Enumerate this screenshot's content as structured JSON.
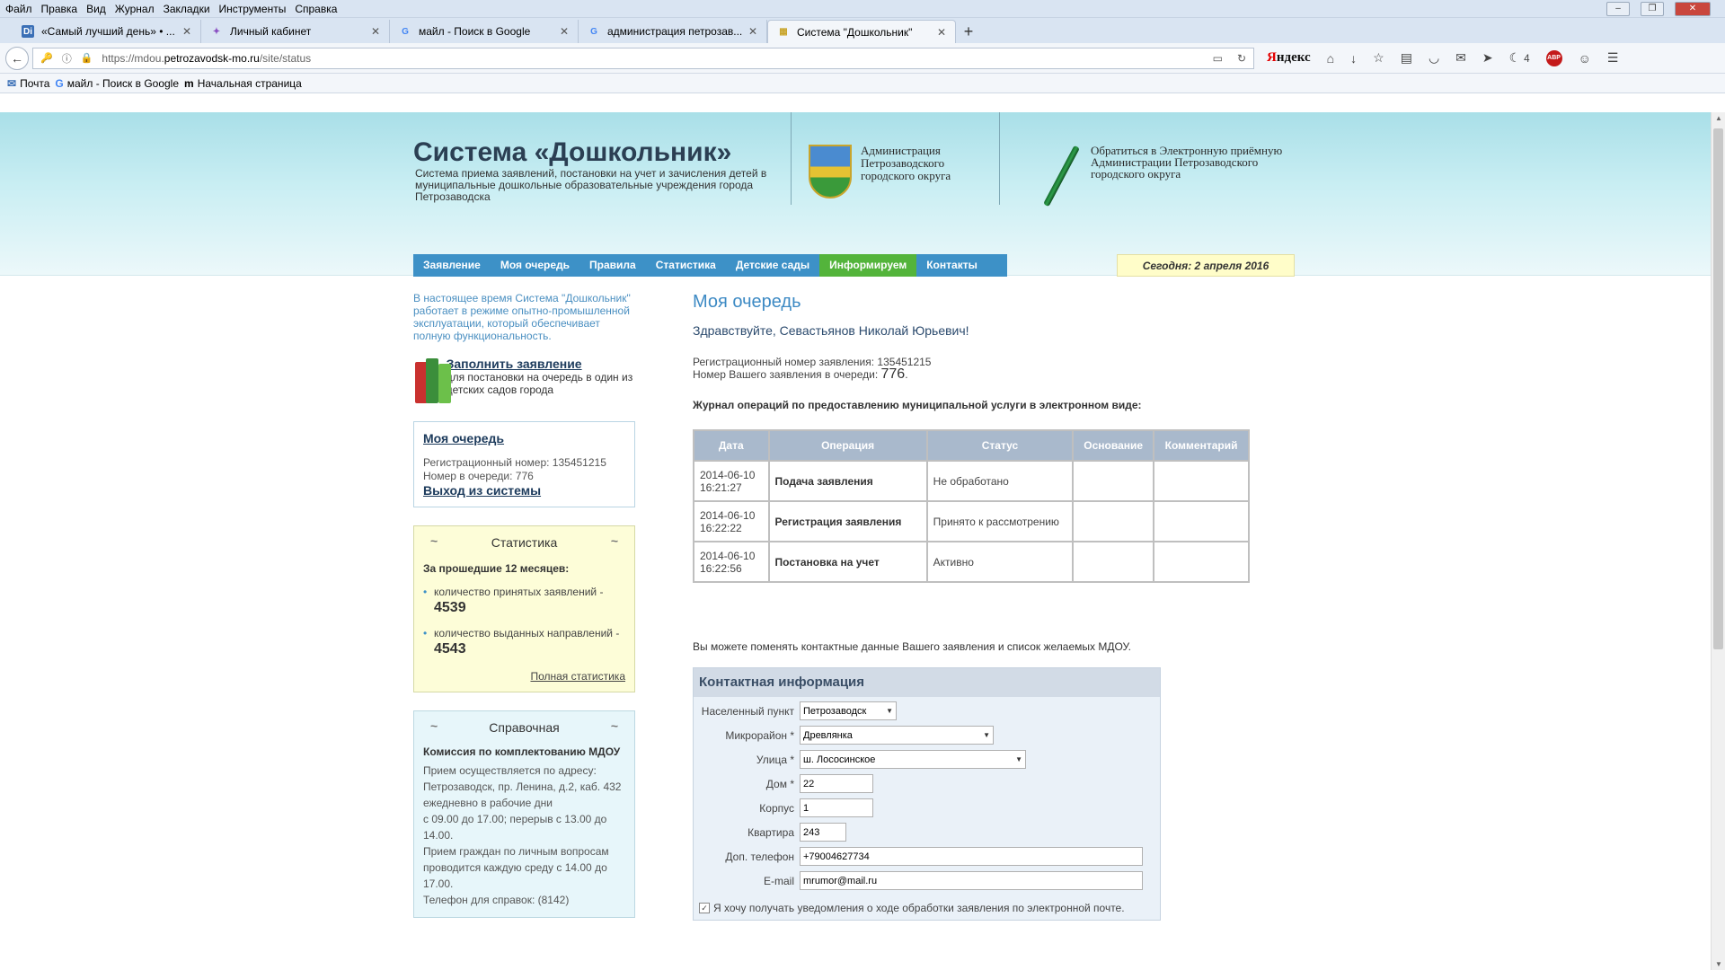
{
  "menubar": {
    "items": [
      "Файл",
      "Правка",
      "Вид",
      "Журнал",
      "Закладки",
      "Инструменты",
      "Справка"
    ]
  },
  "tabs": [
    {
      "label": "«Самый лучший день» • ...",
      "icon": "Di",
      "icon_color": "#3a6fb6"
    },
    {
      "label": "Личный кабинет",
      "icon": "✦",
      "icon_color": "#8a4fc2"
    },
    {
      "label": "майл - Поиск в Google",
      "icon": "G",
      "icon_color": "#4285f4"
    },
    {
      "label": "администрация петрозав...",
      "icon": "G",
      "icon_color": "#4285f4"
    },
    {
      "label": "Система \"Дошкольник\"",
      "icon": "▦",
      "icon_color": "#c9a52b"
    }
  ],
  "url": {
    "prefix": "https://mdou.",
    "domain": "petrozavodsk-mo.ru",
    "path": "/site/status"
  },
  "toolbar": {
    "yandex": "Яндекс",
    "badge": "4",
    "abp": "ABP"
  },
  "bookmarks": [
    {
      "icon": "✉",
      "label": "Почта"
    },
    {
      "icon": "G",
      "label": "майл - Поиск в Google"
    },
    {
      "icon": "m",
      "label": "Начальная страница"
    }
  ],
  "header": {
    "title": "Система «Дошкольник»",
    "subtitle": "Система  приема заявлений, постановки на учет и зачисления детей в муниципальные дошкольные образовательные учреждения города Петрозаводска",
    "admin": [
      "Администрация",
      "Петрозаводского",
      "городского округа"
    ],
    "reception": [
      "Обратиться в Электронную приёмную",
      "Администрации Петрозаводского",
      "городского округа"
    ]
  },
  "nav": [
    "Заявление",
    "Моя очередь",
    "Правила",
    "Статистика",
    "Детские сады",
    "Информируем",
    "Контакты"
  ],
  "today": "Сегодня: 2 апреля 2016",
  "left": {
    "notice": "В настоящее время Система \"Дошкольник\" работает в режиме опытно-промышленной эксплуатации, который обеспечивает полную функциональность.",
    "fill_link": "Заполнить заявление",
    "fill_desc": "для постановки на очередь в один из детских садов города",
    "queue_title": "Моя очередь",
    "reg_line": "Регистрационный номер: 135451215",
    "queue_line": "Номер в очереди: 776",
    "logout": "Выход из системы",
    "stats_title": "Статистика",
    "stats_sub": "За прошедшие 12 месяцев:",
    "stat1_text": "количество принятых заявлений -",
    "stat1_val": "4539",
    "stat2_text": "количество выданных направлений -",
    "stat2_val": "4543",
    "full_stats": "Полная статистика",
    "info_title_head": "Справочная",
    "info_title": "Комиссия по комплектованию МДОУ",
    "info_text1": "Прием осуществляется по адресу: Петрозаводск, пр. Ленина, д.2, каб. 432 ежедневно в рабочие дни",
    "info_text2": "с 09.00 до 17.00; перерыв с 13.00 до 14.00.",
    "info_text3": "Прием граждан по личным вопросам проводится каждую среду с 14.00 до 17.00.",
    "info_text4": "Телефон для справок: (8142)"
  },
  "main": {
    "title": "Моя очередь",
    "greeting": "Здравствуйте, Севастьянов Николай Юрьевич!",
    "reg_label": "Регистрационный номер заявления: 135451215",
    "queue_label": "Номер Вашего заявления в очереди:",
    "queue_num": "776",
    "journal": "Журнал операций по предоставлению муниципальной услуги в электронном виде:",
    "table_headers": [
      "Дата",
      "Операция",
      "Статус",
      "Основание",
      "Комментарий"
    ],
    "rows": [
      {
        "date": "2014-06-10",
        "time": "16:21:27",
        "op": "Подача заявления",
        "status": "Не обработано",
        "basis": "",
        "comment": ""
      },
      {
        "date": "2014-06-10",
        "time": "16:22:22",
        "op": "Регистрация заявления",
        "status": "Принято к рассмотрению",
        "basis": "",
        "comment": ""
      },
      {
        "date": "2014-06-10",
        "time": "16:22:56",
        "op": "Постановка на учет",
        "status": "Активно",
        "basis": "",
        "comment": ""
      }
    ],
    "change_note": "Вы можете поменять контактные данные Вашего заявления и список желаемых МДОУ.",
    "contact_title": "Контактная информация",
    "fields": {
      "city_label": "Населенный пункт",
      "city": "Петрозаводск",
      "district_label": "Микрорайон *",
      "district": "Древлянка",
      "street_label": "Улица *",
      "street": "ш. Лососинское",
      "house_label": "Дом *",
      "house": "22",
      "building_label": "Корпус",
      "building": "1",
      "flat_label": "Квартира",
      "flat": "243",
      "phone_label": "Доп. телефон",
      "phone": "+79004627734",
      "email_label": "E-mail",
      "email": "mrumor@mail.ru"
    },
    "notify": "Я хочу получать уведомления о ходе обработки заявления по электронной почте."
  }
}
